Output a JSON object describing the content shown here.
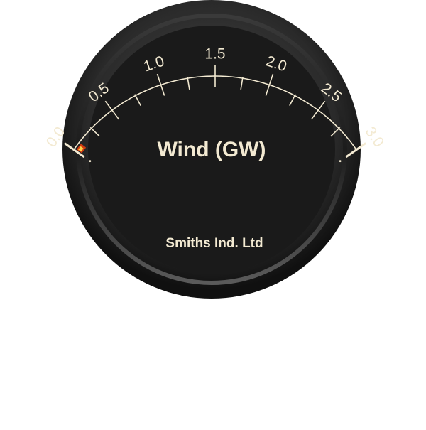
{
  "gauge": {
    "title": "Wind (GW)",
    "maker": "Smiths Ind. Ltd",
    "unit": "GW",
    "scale_min": 0.0,
    "scale_max": 3.0,
    "major_ticks": [
      "0.0",
      "0.5",
      "1.0",
      "1.5",
      "2.0",
      "2.5",
      "3.0"
    ],
    "minor_divisions_per_major": 2,
    "value": 0.04,
    "colors": {
      "face": "#1a1a1a",
      "bezel": "#2c2c2c",
      "scale": "#f3ead2",
      "indicator": "#d03a10",
      "indicator_core": "#ffd24a"
    }
  }
}
